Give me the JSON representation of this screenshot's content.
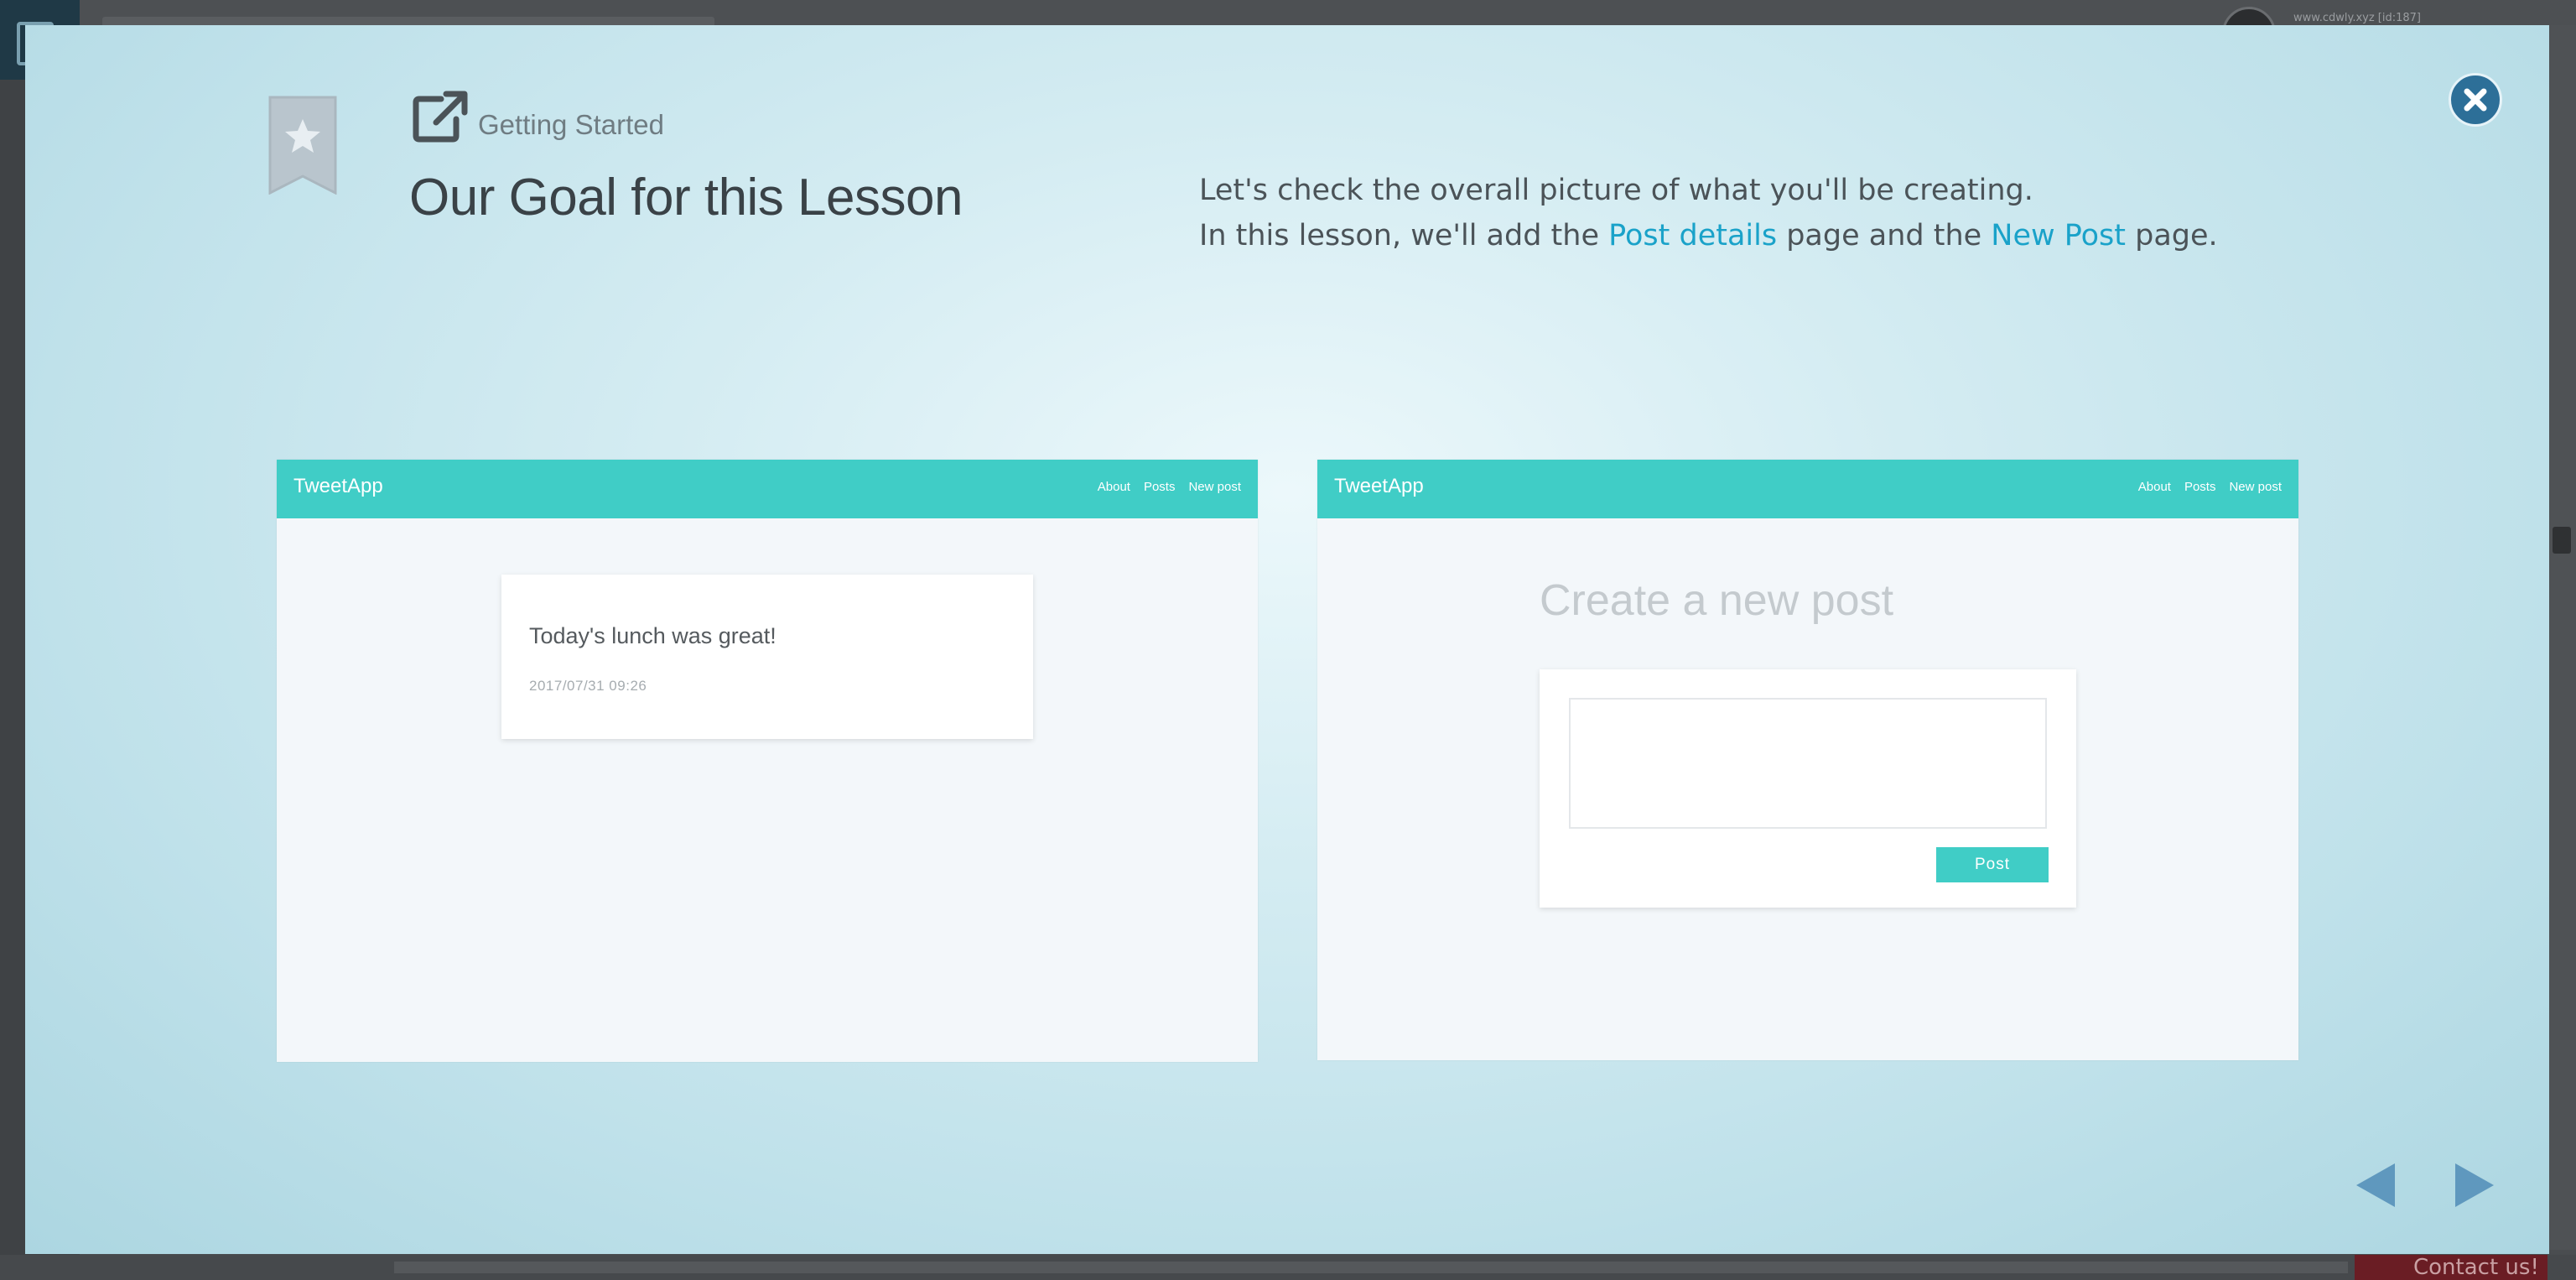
{
  "background": {
    "user_text": "www.cdwly.xyz [id:187]",
    "contact_label": "Contact us!"
  },
  "modal": {
    "kicker": "Getting Started",
    "title": "Our Goal for this Lesson",
    "description": {
      "line1": "Let's check the overall picture of what you'll be creating.",
      "line2_prefix": "In this lesson, we'll add the ",
      "link1": "Post details",
      "line2_middle": " page and the ",
      "link2": "New Post",
      "line2_suffix": " page."
    },
    "icons": {
      "bookmark": "bookmark-star-icon",
      "header": "external-link-icon",
      "close": "close-icon",
      "prev": "prev-arrow-icon",
      "next": "next-arrow-icon"
    },
    "accent_color": "#40cdc6",
    "link_color": "#1aa2c9"
  },
  "preview_left": {
    "brand": "TweetApp",
    "nav": [
      "About",
      "Posts",
      "New post"
    ],
    "post_text": "Today's lunch was great!",
    "post_date": "2017/07/31 09:26"
  },
  "preview_right": {
    "brand": "TweetApp",
    "nav": [
      "About",
      "Posts",
      "New post"
    ],
    "form_title": "Create a new post",
    "post_button": "Post"
  }
}
